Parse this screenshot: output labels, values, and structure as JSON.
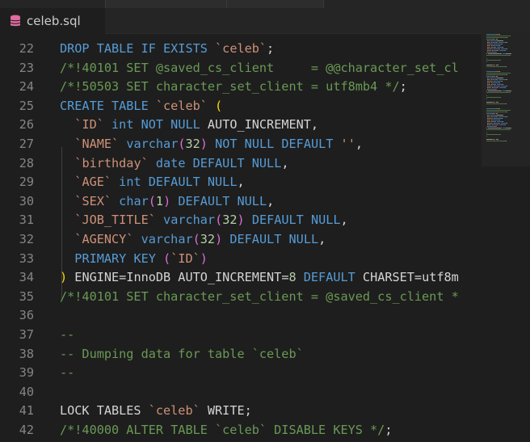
{
  "tab": {
    "title": "celeb.sql",
    "icon": "database-icon",
    "icon_color": "#e06c9f"
  },
  "colors": {
    "keyword": "#569cd6",
    "comment": "#6a9955",
    "string": "#ce9178",
    "number": "#b5cea8",
    "bracket1": "#ffd700",
    "bracket2": "#da70d6"
  },
  "lines": [
    {
      "num": "22",
      "tokens": [
        [
          "kw",
          "DROP TABLE IF EXISTS "
        ],
        [
          "st",
          "`celeb`"
        ],
        [
          "tx",
          ";"
        ]
      ]
    },
    {
      "num": "23",
      "tokens": [
        [
          "cm",
          "/*!40101 SET @saved_cs_client     = @@character_set_cl"
        ]
      ]
    },
    {
      "num": "24",
      "tokens": [
        [
          "cm",
          "/*!50503 SET character_set_client = utf8mb4 */"
        ],
        [
          "tx",
          ";"
        ]
      ]
    },
    {
      "num": "25",
      "tokens": [
        [
          "kw",
          "CREATE TABLE "
        ],
        [
          "st",
          "`celeb`"
        ],
        [
          "tx",
          " "
        ],
        [
          "pa",
          "("
        ]
      ]
    },
    {
      "num": "26",
      "tokens": [
        [
          "tx",
          "  "
        ],
        [
          "st",
          "`ID`"
        ],
        [
          "tx",
          " "
        ],
        [
          "kw",
          "int NOT NULL "
        ],
        [
          "tx",
          "AUTO_INCREMENT,"
        ]
      ]
    },
    {
      "num": "27",
      "tokens": [
        [
          "tx",
          "  "
        ],
        [
          "st",
          "`NAME`"
        ],
        [
          "tx",
          " "
        ],
        [
          "kw",
          "varchar"
        ],
        [
          "pp",
          "("
        ],
        [
          "nm",
          "32"
        ],
        [
          "pp",
          ")"
        ],
        [
          "kw",
          " NOT NULL DEFAULT "
        ],
        [
          "st",
          "''"
        ],
        [
          "tx",
          ","
        ]
      ]
    },
    {
      "num": "28",
      "tokens": [
        [
          "tx",
          "  "
        ],
        [
          "st",
          "`birthday`"
        ],
        [
          "tx",
          " "
        ],
        [
          "kw",
          "date DEFAULT NULL"
        ],
        [
          "tx",
          ","
        ]
      ]
    },
    {
      "num": "29",
      "tokens": [
        [
          "tx",
          "  "
        ],
        [
          "st",
          "`AGE`"
        ],
        [
          "tx",
          " "
        ],
        [
          "kw",
          "int DEFAULT NULL"
        ],
        [
          "tx",
          ","
        ]
      ]
    },
    {
      "num": "30",
      "tokens": [
        [
          "tx",
          "  "
        ],
        [
          "st",
          "`SEX`"
        ],
        [
          "tx",
          " "
        ],
        [
          "kw",
          "char"
        ],
        [
          "pp",
          "("
        ],
        [
          "nm",
          "1"
        ],
        [
          "pp",
          ")"
        ],
        [
          "kw",
          " DEFAULT NULL"
        ],
        [
          "tx",
          ","
        ]
      ]
    },
    {
      "num": "31",
      "tokens": [
        [
          "tx",
          "  "
        ],
        [
          "st",
          "`JOB_TITLE`"
        ],
        [
          "tx",
          " "
        ],
        [
          "kw",
          "varchar"
        ],
        [
          "pp",
          "("
        ],
        [
          "nm",
          "32"
        ],
        [
          "pp",
          ")"
        ],
        [
          "kw",
          " DEFAULT NULL"
        ],
        [
          "tx",
          ","
        ]
      ]
    },
    {
      "num": "32",
      "tokens": [
        [
          "tx",
          "  "
        ],
        [
          "st",
          "`AGENCY`"
        ],
        [
          "tx",
          " "
        ],
        [
          "kw",
          "varchar"
        ],
        [
          "pp",
          "("
        ],
        [
          "nm",
          "32"
        ],
        [
          "pp",
          ")"
        ],
        [
          "kw",
          " DEFAULT NULL"
        ],
        [
          "tx",
          ","
        ]
      ]
    },
    {
      "num": "33",
      "tokens": [
        [
          "tx",
          "  "
        ],
        [
          "kw",
          "PRIMARY KEY "
        ],
        [
          "pp",
          "("
        ],
        [
          "st",
          "`ID`"
        ],
        [
          "pp",
          ")"
        ]
      ]
    },
    {
      "num": "34",
      "tokens": [
        [
          "pa",
          ")"
        ],
        [
          "tx",
          " ENGINE=InnoDB AUTO_INCREMENT="
        ],
        [
          "nm",
          "8"
        ],
        [
          "kw",
          " DEFAULT "
        ],
        [
          "tx",
          "CHARSET=utf8m"
        ]
      ]
    },
    {
      "num": "35",
      "tokens": [
        [
          "cm",
          "/*!40101 SET character_set_client = @saved_cs_client *"
        ]
      ]
    },
    {
      "num": "36",
      "tokens": []
    },
    {
      "num": "37",
      "tokens": [
        [
          "cm",
          "--"
        ]
      ]
    },
    {
      "num": "38",
      "tokens": [
        [
          "cm",
          "-- Dumping data for table `celeb`"
        ]
      ]
    },
    {
      "num": "39",
      "tokens": [
        [
          "cm",
          "--"
        ]
      ]
    },
    {
      "num": "40",
      "tokens": []
    },
    {
      "num": "41",
      "tokens": [
        [
          "tx",
          "LOCK TABLES "
        ],
        [
          "st",
          "`celeb`"
        ],
        [
          "tx",
          " WRITE;"
        ]
      ]
    },
    {
      "num": "42",
      "tokens": [
        [
          "cm",
          "/*!40000 ALTER TABLE `celeb` DISABLE KEYS */"
        ],
        [
          "tx",
          ";"
        ]
      ]
    }
  ]
}
